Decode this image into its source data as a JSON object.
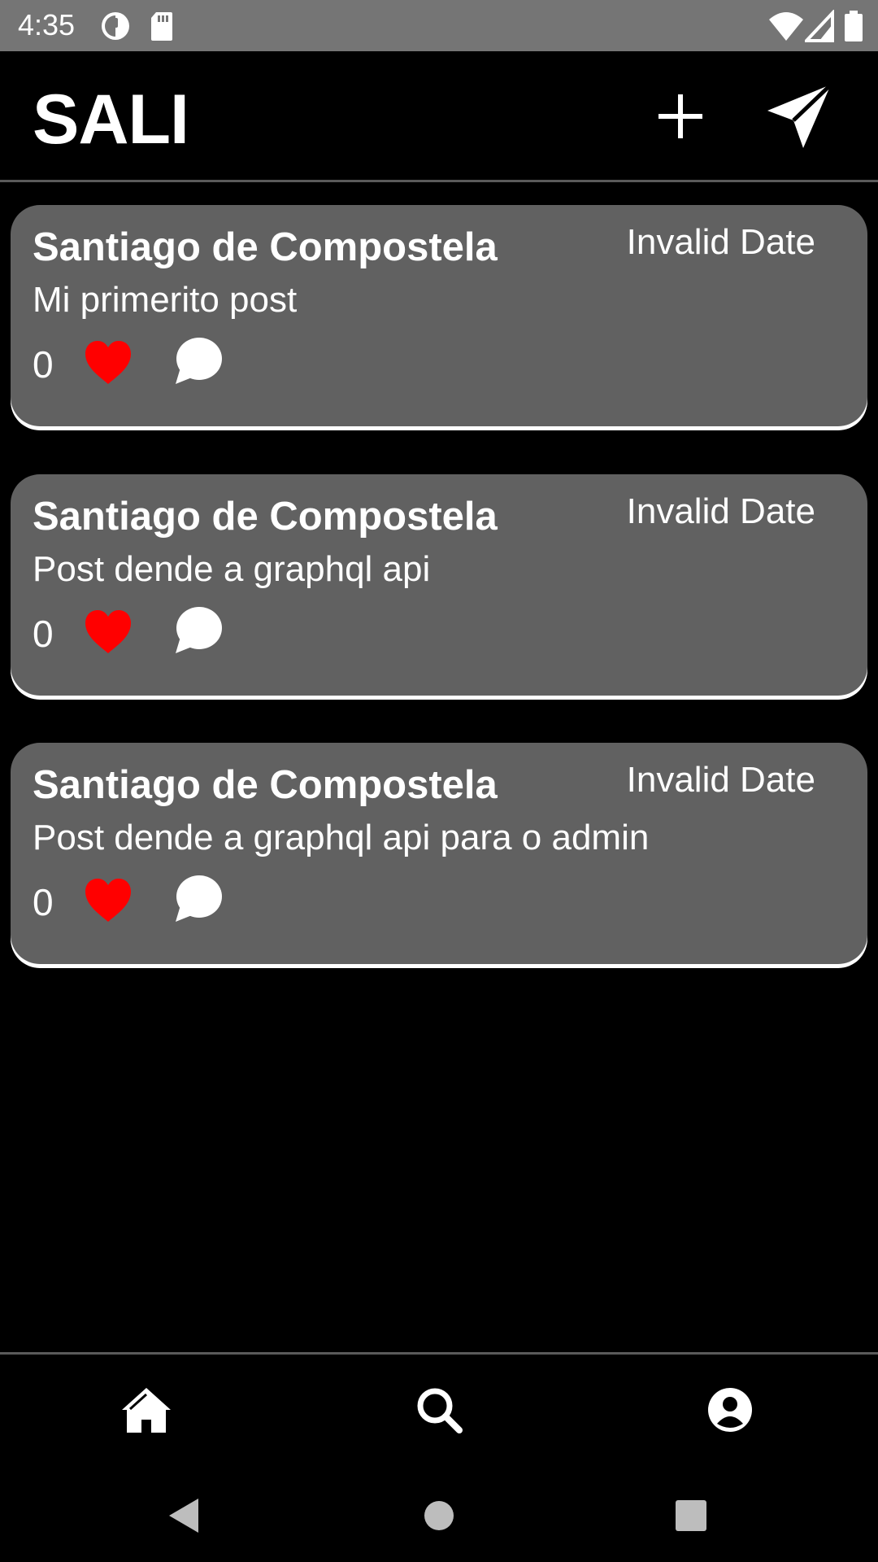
{
  "status_bar": {
    "time": "4:35",
    "icons": [
      "data-saver-icon",
      "sd-card-icon",
      "wifi-icon",
      "cellular-signal-icon",
      "battery-icon"
    ],
    "background": "#757575"
  },
  "app_bar": {
    "title": "SALI",
    "actions": [
      "add-icon",
      "send-icon"
    ]
  },
  "posts": [
    {
      "author": "Santiago de Compostela",
      "date": "Invalid Date",
      "body": "Mi primerito post",
      "likes": "0"
    },
    {
      "author": "Santiago de Compostela",
      "date": "Invalid Date",
      "body": "Post dende a graphql api",
      "likes": "0"
    },
    {
      "author": "Santiago de Compostela",
      "date": "Invalid Date",
      "body": "Post dende a graphql api para o admin",
      "likes": "0"
    }
  ],
  "bottom_nav": {
    "items": [
      "home-icon",
      "search-icon",
      "account-icon"
    ]
  },
  "system_nav": {
    "items": [
      "back-icon",
      "home-circle-icon",
      "recents-icon"
    ]
  },
  "colors": {
    "background": "#000000",
    "card": "#616161",
    "heart": "#ff0000",
    "text": "#ffffff"
  }
}
